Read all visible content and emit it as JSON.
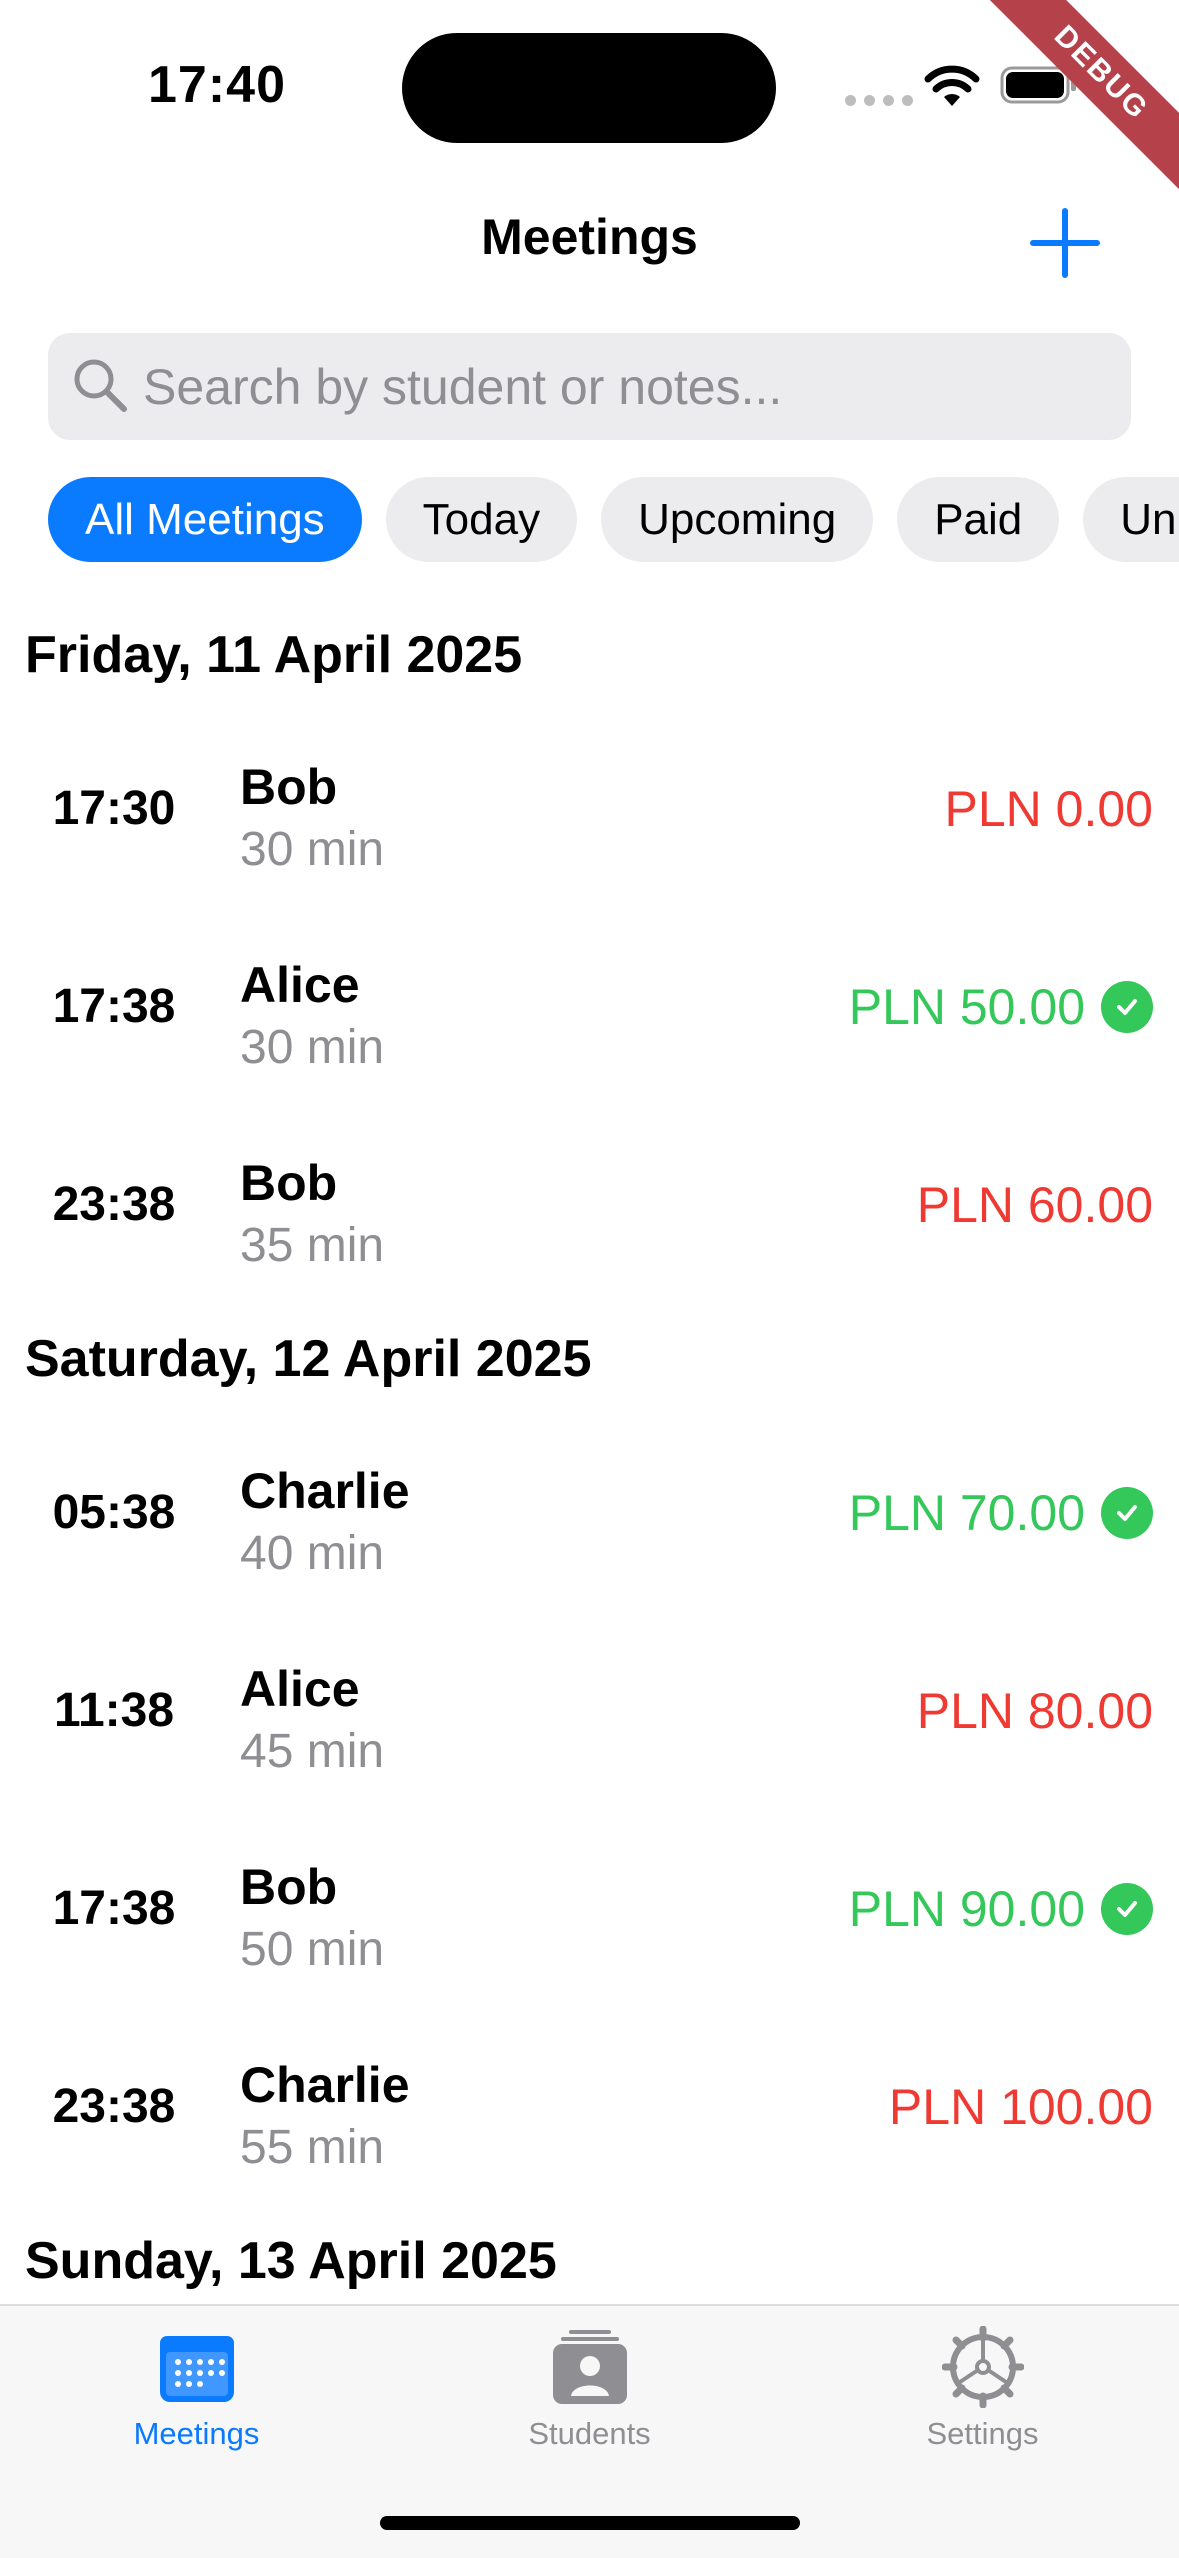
{
  "status_bar": {
    "time": "17:40",
    "debug_label": "DEBUG"
  },
  "header": {
    "title": "Meetings",
    "add_icon": "plus-icon"
  },
  "search": {
    "placeholder": "Search by student or notes...",
    "value": ""
  },
  "filters": [
    {
      "label": "All Meetings",
      "active": true
    },
    {
      "label": "Today",
      "active": false
    },
    {
      "label": "Upcoming",
      "active": false
    },
    {
      "label": "Paid",
      "active": false
    },
    {
      "label": "Unpaid",
      "active": false
    }
  ],
  "sections": [
    {
      "date": "Friday, 11 April 2025",
      "meetings": [
        {
          "time": "17:30",
          "student": "Bob",
          "duration": "30 min",
          "amount": "PLN 0.00",
          "paid": false
        },
        {
          "time": "17:38",
          "student": "Alice",
          "duration": "30 min",
          "amount": "PLN 50.00",
          "paid": true
        },
        {
          "time": "23:38",
          "student": "Bob",
          "duration": "35 min",
          "amount": "PLN 60.00",
          "paid": false
        }
      ]
    },
    {
      "date": "Saturday, 12 April 2025",
      "meetings": [
        {
          "time": "05:38",
          "student": "Charlie",
          "duration": "40 min",
          "amount": "PLN 70.00",
          "paid": true
        },
        {
          "time": "11:38",
          "student": "Alice",
          "duration": "45 min",
          "amount": "PLN 80.00",
          "paid": false
        },
        {
          "time": "17:38",
          "student": "Bob",
          "duration": "50 min",
          "amount": "PLN 90.00",
          "paid": true
        },
        {
          "time": "23:38",
          "student": "Charlie",
          "duration": "55 min",
          "amount": "PLN 100.00",
          "paid": false
        }
      ]
    },
    {
      "date": "Sunday, 13 April 2025",
      "meetings": []
    }
  ],
  "tabs": [
    {
      "label": "Meetings",
      "icon": "calendar-icon",
      "active": true
    },
    {
      "label": "Students",
      "icon": "person-card-icon",
      "active": false
    },
    {
      "label": "Settings",
      "icon": "gear-icon",
      "active": false
    }
  ],
  "colors": {
    "accent": "#0a7aff",
    "paid": "#34c759",
    "unpaid": "#ef3a34",
    "secondary_text": "#8e8e93"
  }
}
